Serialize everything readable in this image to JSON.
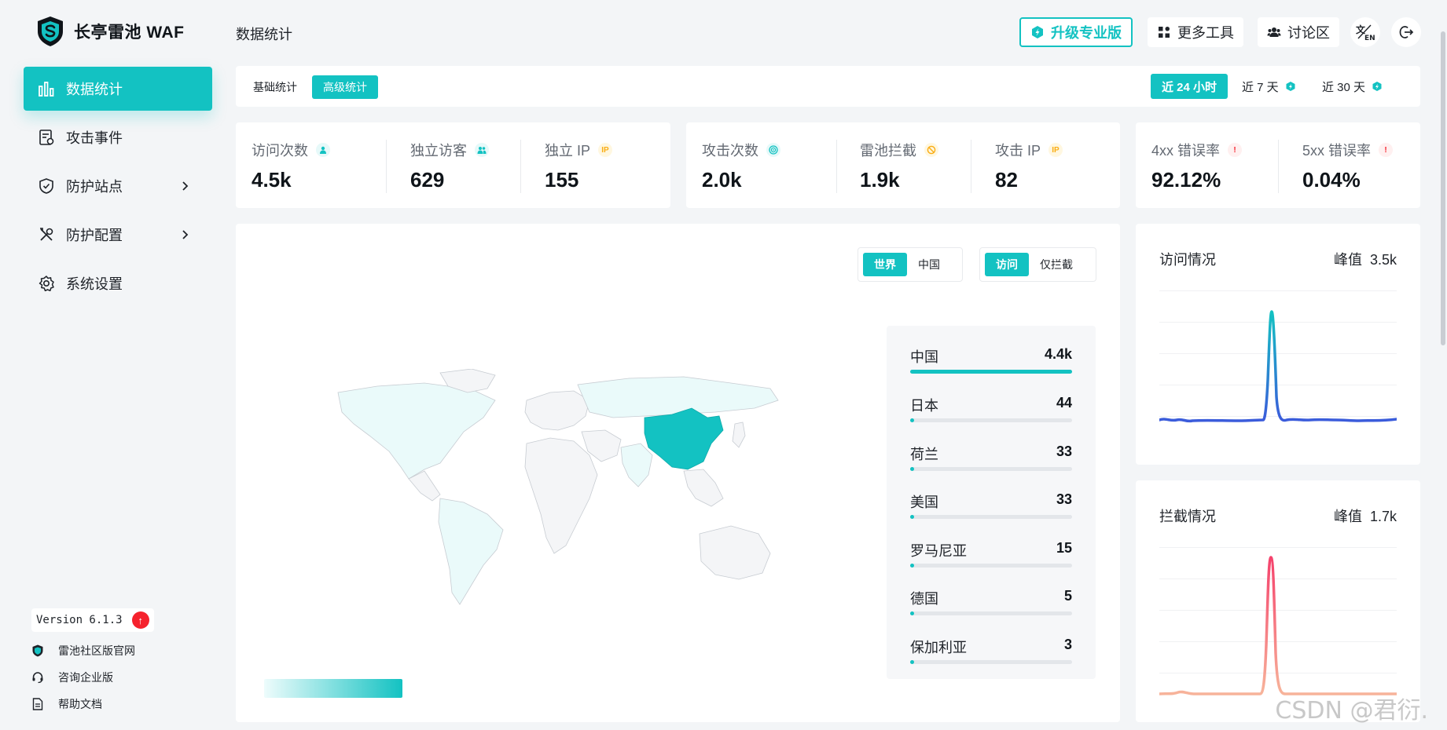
{
  "app": {
    "title": "长亭雷池 WAF",
    "page_title": "数据统计"
  },
  "sidebar": {
    "items": [
      {
        "label": "数据统计",
        "icon": "bar-chart-icon",
        "active": true
      },
      {
        "label": "攻击事件",
        "icon": "document-icon",
        "active": false
      },
      {
        "label": "防护站点",
        "icon": "shield-icon",
        "active": false,
        "expandable": true
      },
      {
        "label": "防护配置",
        "icon": "tools-icon",
        "active": false,
        "expandable": true
      },
      {
        "label": "系统设置",
        "icon": "gear-icon",
        "active": false
      }
    ],
    "version": "Version 6.1.3",
    "links": [
      "雷池社区版官网",
      "咨询企业版",
      "帮助文档"
    ]
  },
  "header": {
    "upgrade": "升级专业版",
    "tools": "更多工具",
    "forum": "讨论区",
    "lang": "EN"
  },
  "tabs": {
    "basic": "基础统计",
    "advanced": "高级统计"
  },
  "ranges": [
    "近 24 小时",
    "近 7 天",
    "近 30 天"
  ],
  "stats": {
    "group1": [
      {
        "label": "访问次数",
        "value": "4.5k"
      },
      {
        "label": "独立访客",
        "value": "629"
      },
      {
        "label": "独立 IP",
        "value": "155",
        "badge": "IP"
      }
    ],
    "group2": [
      {
        "label": "攻击次数",
        "value": "2.0k"
      },
      {
        "label": "雷池拦截",
        "value": "1.9k"
      },
      {
        "label": "攻击 IP",
        "value": "82",
        "badge": "IP"
      }
    ],
    "group3": [
      {
        "label": "4xx 错误率",
        "value": "92.12%",
        "badge": "!"
      },
      {
        "label": "5xx 错误率",
        "value": "0.04%",
        "badge": "!"
      }
    ]
  },
  "map": {
    "scope": [
      "世界",
      "中国"
    ],
    "mode": [
      "访问",
      "仅拦截"
    ],
    "ranking": [
      {
        "name": "中国",
        "value": "4.4k",
        "fraction": 1.0
      },
      {
        "name": "日本",
        "value": "44",
        "fraction": 0.012
      },
      {
        "name": "荷兰",
        "value": "33",
        "fraction": 0.009
      },
      {
        "name": "美国",
        "value": "33",
        "fraction": 0.009
      },
      {
        "name": "罗马尼亚",
        "value": "15",
        "fraction": 0.005
      },
      {
        "name": "德国",
        "value": "5",
        "fraction": 0.002
      },
      {
        "name": "保加利亚",
        "value": "3",
        "fraction": 0.001
      }
    ]
  },
  "charts": {
    "visits": {
      "title": "访问情况",
      "peak_label": "峰值",
      "peak_value": "3.5k",
      "color_top": "#13c2c2",
      "color_bottom": "#3b5bdb"
    },
    "blocks": {
      "title": "拦截情况",
      "peak_label": "峰值",
      "peak_value": "1.7k",
      "color_top": "#f5426c",
      "color_bottom": "#f7b39a"
    }
  },
  "colors": {
    "accent": "#13c2c2",
    "danger": "#f5222d",
    "warning": "#faad14"
  },
  "watermark": "CSDN @君衍."
}
